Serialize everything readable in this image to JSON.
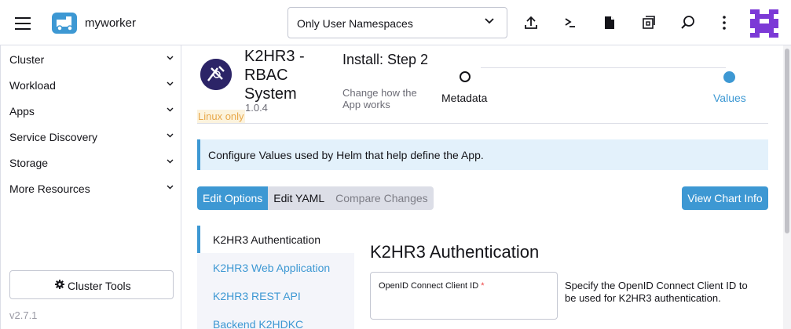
{
  "header": {
    "cluster_name": "myworker",
    "namespace_filter": "Only User Namespaces",
    "icons": [
      "menu-icon",
      "upload-icon",
      "shell-icon",
      "file-icon",
      "copy-config-icon",
      "search-icon",
      "more-icon"
    ]
  },
  "sidebar": {
    "items": [
      {
        "label": "Cluster"
      },
      {
        "label": "Workload"
      },
      {
        "label": "Apps"
      },
      {
        "label": "Service Discovery"
      },
      {
        "label": "Storage"
      },
      {
        "label": "More Resources"
      }
    ],
    "cluster_tools": "Cluster Tools",
    "version": "v2.7.1"
  },
  "app": {
    "name": "K2HR3 - RBAC System",
    "version": "1.0.4",
    "os_badge": "Linux only"
  },
  "wizard": {
    "title": "Install: Step 2",
    "subtitle": "Change how the App works",
    "steps": [
      {
        "label": "Metadata",
        "state": "done"
      },
      {
        "label": "Values",
        "state": "current"
      }
    ]
  },
  "banner": "Configure Values used by Helm that help define the App.",
  "tabs": [
    {
      "label": "Edit Options",
      "state": "active"
    },
    {
      "label": "Edit YAML",
      "state": "normal"
    },
    {
      "label": "Compare Changes",
      "state": "disabled"
    }
  ],
  "chart_info_button": "View Chart Info",
  "config_tabs": [
    {
      "label": "K2HR3 Authentication",
      "active": true
    },
    {
      "label": "K2HR3 Web Application",
      "active": false
    },
    {
      "label": "K2HR3 REST API",
      "active": false
    },
    {
      "label": "Backend K2HDKC",
      "active": false
    }
  ],
  "section": {
    "title": "K2HR3 Authentication",
    "field_label": "OpenID Connect Client ID",
    "field_required_mark": "*",
    "field_help": "Specify the OpenID Connect Client ID to be used for K2HR3 authentication."
  },
  "colors": {
    "accent": "#3d98d3",
    "badge_text": "#e8a84b",
    "banner_bg": "#e3f1fb",
    "avatar": "#7c3ad6"
  }
}
